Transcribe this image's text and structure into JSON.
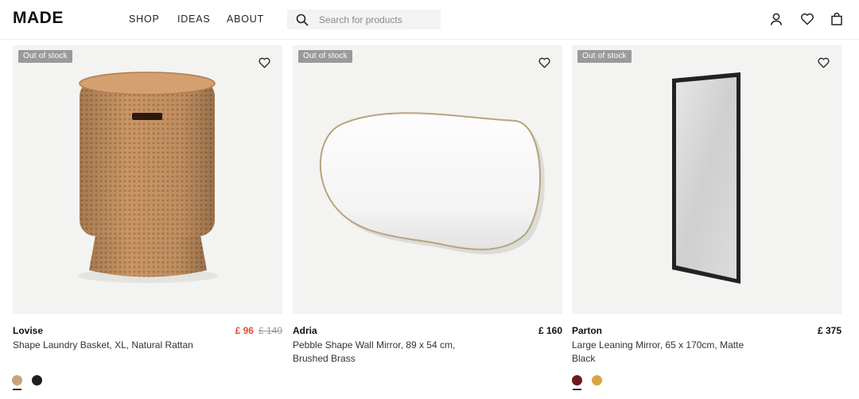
{
  "brand": "MADE",
  "nav": [
    "SHOP",
    "IDEAS",
    "ABOUT"
  ],
  "search": {
    "placeholder": "Search for products"
  },
  "header_icons": [
    "account-icon",
    "wishlist-heart-icon",
    "bag-icon"
  ],
  "products": [
    {
      "badge": "Out of stock",
      "name": "Lovise",
      "desc": "Shape Laundry Basket, XL, Natural Rattan",
      "price": "£ 96",
      "was_price": "£ 140",
      "swatches": [
        "#c9a27a",
        "#1e1e1e"
      ]
    },
    {
      "badge": "Out of stock",
      "name": "Adria",
      "desc": "Pebble Shape Wall Mirror, 89 x 54 cm, Brushed Brass",
      "price": "£ 160"
    },
    {
      "badge": "Out of stock",
      "name": "Parton",
      "desc": "Large Leaning Mirror, 65 x 170cm, Matte Black",
      "price": "£ 375",
      "swatches": [
        "#6e1a1a",
        "#d9a441"
      ]
    }
  ],
  "colors": {
    "sale_price": "#e04b3c",
    "badge_bg": "#9a9a9a",
    "image_bg": "#f3f3f1"
  }
}
